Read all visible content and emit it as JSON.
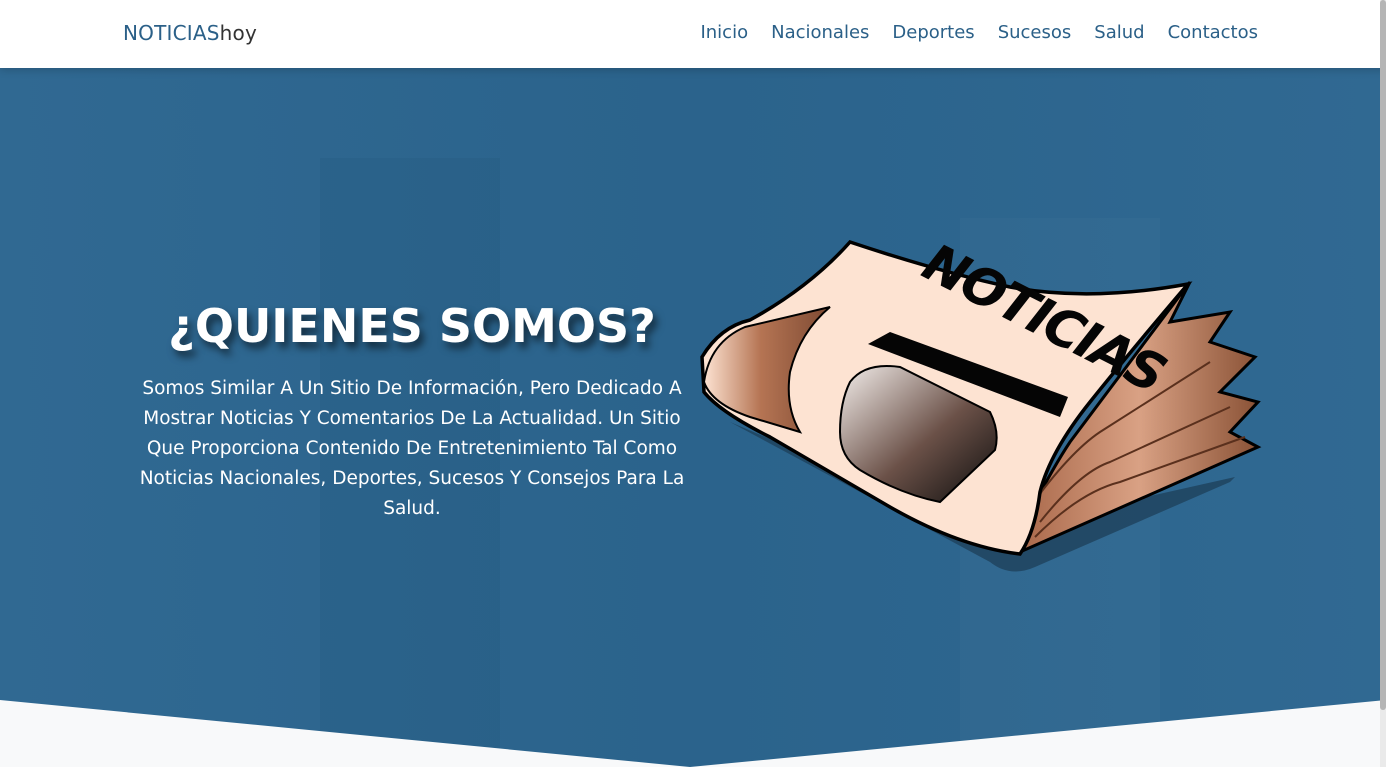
{
  "header": {
    "brand_primary": "NOTICIAS",
    "brand_secondary": "hoy"
  },
  "nav": {
    "items": [
      {
        "label": "Inicio"
      },
      {
        "label": "Nacionales"
      },
      {
        "label": "Deportes"
      },
      {
        "label": "Sucesos"
      },
      {
        "label": "Salud"
      },
      {
        "label": "Contactos"
      }
    ]
  },
  "hero": {
    "title": "¿QUIENES SOMOS?",
    "description": "Somos Similar A Un Sitio De Información, Pero Dedicado A Mostrar Noticias Y Comentarios De La Actualidad. Un Sitio Que Proporciona Contenido De Entretenimiento Tal Como Noticias Nacionales, Deportes, Sucesos Y Consejos Para La Salud.",
    "illustration": {
      "icon": "newspaper-illustration",
      "masthead_text": "NOTICIAS"
    }
  },
  "colors": {
    "brand": "#2b6088",
    "hero_bg": "#2c6690",
    "paper_light": "#fde3d2",
    "paper_dark": "#a9684a",
    "section_bg": "#f8f9fa"
  }
}
